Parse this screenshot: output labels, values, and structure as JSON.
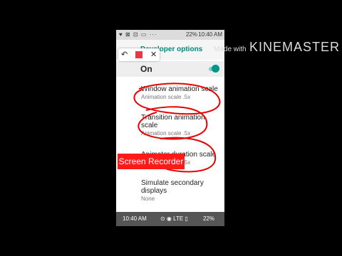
{
  "status_bar": {
    "left_icons": "♥ ⊠ ⊡ ▭ ···",
    "battery": "22%",
    "time": "10:40 AM"
  },
  "app_bar": {
    "title": "Developer options"
  },
  "recorder_toolbar": {
    "undo_icon": "↶",
    "close_icon": "✕",
    "stop_color": "#e53947"
  },
  "master_switch": {
    "label": "On",
    "enabled": true
  },
  "settings": [
    {
      "title": "Window animation scale",
      "subtitle": "Animation scale .5x"
    },
    {
      "title": "Transition animation scale",
      "subtitle": "Animation scale .5x"
    },
    {
      "title": "Animator duration scale",
      "subtitle": "Animation scale .5x"
    },
    {
      "title": "Simulate secondary displays",
      "subtitle": "None"
    }
  ],
  "nav_bar": {
    "time": "10:40 AM",
    "icons": "⊙ ◉ LTE ▯",
    "battery": "22%"
  },
  "watermark": {
    "prefix": "Made with",
    "brand": "KINEMASTER"
  },
  "screen_recorder_label": "Screen Recorder",
  "colors": {
    "accent": "#009688",
    "scribble": "#e60000",
    "recorder_bg": "#ff1a1a"
  }
}
